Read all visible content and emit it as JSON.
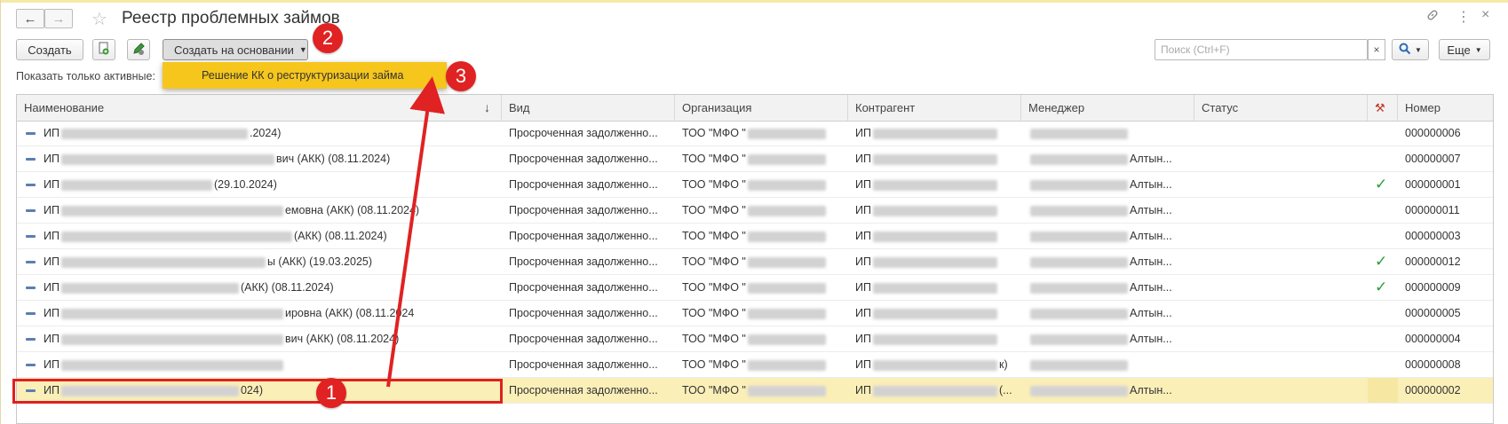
{
  "window": {
    "title": "Реестр проблемных займов"
  },
  "toolbar": {
    "create_label": "Создать",
    "create_basis_label": "Создать на основании",
    "more_label": "Еще"
  },
  "search": {
    "placeholder": "Поиск (Ctrl+F)"
  },
  "filter": {
    "active_label": "Показать только активные:"
  },
  "dropdown": {
    "items": [
      "Решение КК о реструктуризации займа"
    ]
  },
  "table": {
    "columns": [
      "Наименование",
      "Вид",
      "Организация",
      "Контрагент",
      "Менеджер",
      "Статус",
      "Номер"
    ],
    "rows": [
      {
        "name_prefix": "ИП",
        "name_suffix": ".2024)",
        "kind": "Просроченная задолженно...",
        "org": "ТОО \"МФО \"",
        "counterparty": "ИП",
        "cp_suffix": "",
        "manager_suffix": "",
        "status": "",
        "check": false,
        "number": "000000006"
      },
      {
        "name_prefix": "ИП",
        "name_suffix": "вич (АКК) (08.11.2024)",
        "kind": "Просроченная задолженно...",
        "org": "ТОО \"МФО \"",
        "counterparty": "ИП",
        "cp_suffix": "",
        "manager_suffix": "Алтын...",
        "status": "",
        "check": false,
        "number": "000000007"
      },
      {
        "name_prefix": "ИП",
        "name_suffix": "(29.10.2024)",
        "kind": "Просроченная задолженно...",
        "org": "ТОО \"МФО \"",
        "counterparty": "ИП",
        "cp_suffix": "",
        "manager_suffix": "Алтын...",
        "status": "",
        "check": true,
        "number": "000000001"
      },
      {
        "name_prefix": "ИП",
        "name_suffix": "емовна (АКК) (08.11.2024)",
        "kind": "Просроченная задолженно...",
        "org": "ТОО \"МФО \"",
        "counterparty": "ИП",
        "cp_suffix": "",
        "manager_suffix": "Алтын...",
        "status": "",
        "check": false,
        "number": "000000011"
      },
      {
        "name_prefix": "ИП",
        "name_suffix": "(АКК) (08.11.2024)",
        "kind": "Просроченная задолженно...",
        "org": "ТОО \"МФО \"",
        "counterparty": "ИП",
        "cp_suffix": "",
        "manager_suffix": "Алтын...",
        "status": "",
        "check": false,
        "number": "000000003"
      },
      {
        "name_prefix": "ИП",
        "name_suffix": "ы (АКК) (19.03.2025)",
        "kind": "Просроченная задолженно...",
        "org": "ТОО \"МФО \"",
        "counterparty": "ИП",
        "cp_suffix": "",
        "manager_suffix": "Алтын...",
        "status": "",
        "check": true,
        "number": "000000012"
      },
      {
        "name_prefix": "ИП",
        "name_suffix": "(АКК) (08.11.2024)",
        "kind": "Просроченная задолженно...",
        "org": "ТОО \"МФО \"",
        "counterparty": "ИП",
        "cp_suffix": "",
        "manager_suffix": "Алтын...",
        "status": "",
        "check": true,
        "number": "000000009"
      },
      {
        "name_prefix": "ИП",
        "name_suffix": "ировна (АКК) (08.11.2024",
        "kind": "Просроченная задолженно...",
        "org": "ТОО \"МФО \"",
        "counterparty": "ИП",
        "cp_suffix": "",
        "manager_suffix": "Алтын...",
        "status": "",
        "check": false,
        "number": "000000005"
      },
      {
        "name_prefix": "ИП",
        "name_suffix": "вич (АКК) (08.11.2024)",
        "kind": "Просроченная задолженно...",
        "org": "ТОО \"МФО \"",
        "counterparty": "ИП",
        "cp_suffix": "",
        "manager_suffix": "Алтын...",
        "status": "",
        "check": false,
        "number": "000000004"
      },
      {
        "name_prefix": "ИП",
        "name_suffix": "",
        "kind": "Просроченная задолженно...",
        "org": "ТОО \"МФО \"",
        "counterparty": "ИП",
        "cp_suffix": "к)",
        "manager_suffix": "",
        "status": "",
        "check": false,
        "number": "000000008"
      },
      {
        "name_prefix": "ИП",
        "name_suffix": "024)",
        "kind": "Просроченная задолженно...",
        "org": "ТОО \"МФО \"",
        "counterparty": "ИП",
        "cp_suffix": "(...",
        "manager_suffix": "Алтын...",
        "status": "",
        "check": false,
        "number": "000000002",
        "selected": true
      }
    ]
  },
  "annotations": {
    "badges": [
      "1",
      "2",
      "3"
    ],
    "color": "#e02222"
  },
  "colors": {
    "selection": "#fbefb8",
    "dropdown": "#f6c61d",
    "check": "#2e9a3b"
  }
}
